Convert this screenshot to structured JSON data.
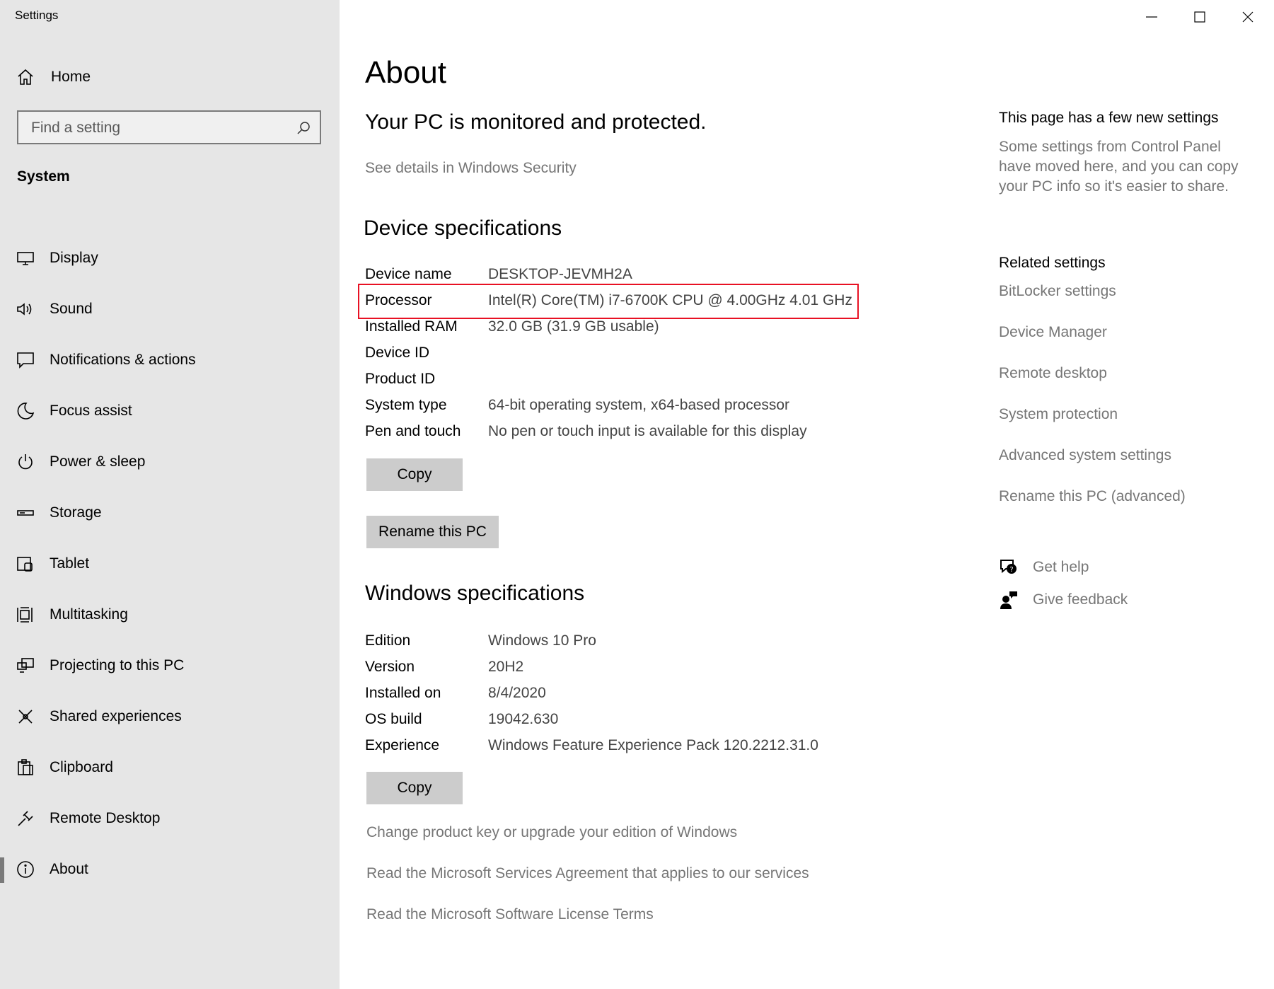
{
  "window": {
    "title": "Settings",
    "controls": {
      "minimize": "minimize-icon",
      "maximize": "maximize-icon",
      "close": "close-icon"
    }
  },
  "sidebar": {
    "home_label": "Home",
    "search_placeholder": "Find a setting",
    "section_label": "System",
    "selected": "About",
    "items": [
      {
        "label": "Display",
        "icon": "monitor-icon"
      },
      {
        "label": "Sound",
        "icon": "speaker-icon"
      },
      {
        "label": "Notifications & actions",
        "icon": "notification-icon"
      },
      {
        "label": "Focus assist",
        "icon": "moon-icon"
      },
      {
        "label": "Power & sleep",
        "icon": "power-icon"
      },
      {
        "label": "Storage",
        "icon": "storage-icon"
      },
      {
        "label": "Tablet",
        "icon": "tablet-icon"
      },
      {
        "label": "Multitasking",
        "icon": "multitasking-icon"
      },
      {
        "label": "Projecting to this PC",
        "icon": "projecting-icon"
      },
      {
        "label": "Shared experiences",
        "icon": "shared-experiences-icon"
      },
      {
        "label": "Clipboard",
        "icon": "clipboard-icon"
      },
      {
        "label": "Remote Desktop",
        "icon": "remote-desktop-icon"
      },
      {
        "label": "About",
        "icon": "info-icon"
      }
    ]
  },
  "main": {
    "title": "About",
    "security_heading": "Your PC is monitored and protected.",
    "security_link": "See details in Windows Security",
    "device_specs_heading": "Device specifications",
    "device_specs": [
      {
        "label": "Device name",
        "value": "DESKTOP-JEVMH2A"
      },
      {
        "label": "Processor",
        "value": "Intel(R) Core(TM) i7-6700K CPU @ 4.00GHz   4.01 GHz"
      },
      {
        "label": "Installed RAM",
        "value": "32.0 GB (31.9 GB usable)"
      },
      {
        "label": "Device ID",
        "value": ""
      },
      {
        "label": "Product ID",
        "value": ""
      },
      {
        "label": "System type",
        "value": "64-bit operating system, x64-based processor"
      },
      {
        "label": "Pen and touch",
        "value": "No pen or touch input is available for this display"
      }
    ],
    "highlight_color": "#e81123",
    "copy_label": "Copy",
    "rename_label": "Rename this PC",
    "windows_specs_heading": "Windows specifications",
    "windows_specs": [
      {
        "label": "Edition",
        "value": "Windows 10 Pro"
      },
      {
        "label": "Version",
        "value": "20H2"
      },
      {
        "label": "Installed on",
        "value": "8/4/2020"
      },
      {
        "label": "OS build",
        "value": "19042.630"
      },
      {
        "label": "Experience",
        "value": "Windows Feature Experience Pack 120.2212.31.0"
      }
    ],
    "windows_copy_label": "Copy",
    "bottom_links": [
      "Change product key or upgrade your edition of Windows",
      "Read the Microsoft Services Agreement that applies to our services",
      "Read the Microsoft Software License Terms"
    ]
  },
  "right_panel": {
    "new_settings_title": "This page has a few new settings",
    "new_settings_desc": "Some settings from Control Panel have moved here, and you can copy your PC info so it's easier to share.",
    "related_title": "Related settings",
    "related_links": [
      "BitLocker settings",
      "Device Manager",
      "Remote desktop",
      "System protection",
      "Advanced system settings",
      "Rename this PC (advanced)"
    ],
    "help_links": [
      {
        "label": "Get help",
        "icon": "get-help-icon"
      },
      {
        "label": "Give feedback",
        "icon": "feedback-icon"
      }
    ]
  }
}
